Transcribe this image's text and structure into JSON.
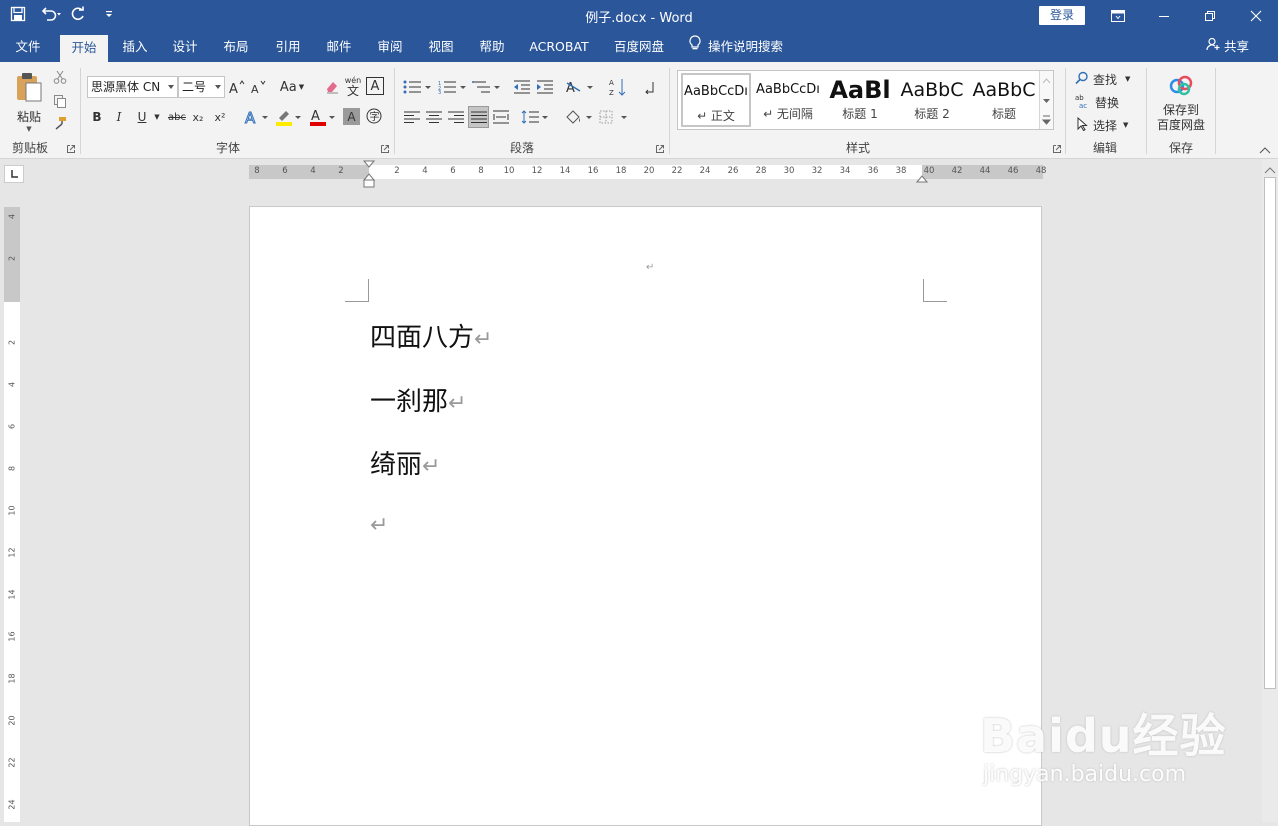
{
  "window": {
    "title": "例子.docx  -  Word",
    "login_label": "登录"
  },
  "tabs": [
    {
      "label": "文件"
    },
    {
      "label": "开始"
    },
    {
      "label": "插入"
    },
    {
      "label": "设计"
    },
    {
      "label": "布局"
    },
    {
      "label": "引用"
    },
    {
      "label": "邮件"
    },
    {
      "label": "审阅"
    },
    {
      "label": "视图"
    },
    {
      "label": "帮助"
    },
    {
      "label": "ACROBAT"
    },
    {
      "label": "百度网盘"
    }
  ],
  "tell_me": "操作说明搜索",
  "share": "共享",
  "ribbon": {
    "clipboard": {
      "paste_label": "粘贴",
      "group_label": "剪贴板"
    },
    "font": {
      "font_name": "思源黑体 CN",
      "font_size": "二号",
      "group_label": "字体",
      "aa_label": "Aa",
      "bold": "B",
      "italic": "I",
      "underline": "U",
      "strike": "abc",
      "sub": "x₂",
      "sup": "x²",
      "wen_label": "wén",
      "wen_char": "文",
      "a_label": "A"
    },
    "paragraph": {
      "group_label": "段落"
    },
    "styles": {
      "group_label": "样式",
      "items": [
        {
          "preview": "AaBbCcDı",
          "name": "↵ 正文"
        },
        {
          "preview": "AaBbCcDı",
          "name": "↵ 无间隔"
        },
        {
          "preview": "AaBl",
          "name": "标题 1"
        },
        {
          "preview": "AaBbC",
          "name": "标题 2"
        },
        {
          "preview": "AaBbC",
          "name": "标题"
        }
      ]
    },
    "editing": {
      "find": "查找",
      "replace": "替换",
      "select": "选择",
      "group_label": "编辑"
    },
    "save": {
      "line1": "保存到",
      "line2": "百度网盘",
      "group_label": "保存"
    }
  },
  "ruler_h": [
    "8",
    "6",
    "4",
    "2",
    "2",
    "4",
    "6",
    "8",
    "10",
    "12",
    "14",
    "16",
    "18",
    "20",
    "22",
    "24",
    "26",
    "28",
    "30",
    "32",
    "34",
    "36",
    "38",
    "40",
    "42",
    "44",
    "46",
    "48"
  ],
  "ruler_v": [
    "4",
    "2",
    "2",
    "4",
    "6",
    "8",
    "10",
    "12",
    "14",
    "16",
    "18",
    "20",
    "22",
    "24"
  ],
  "document": {
    "header_mark": "↵",
    "paragraphs": [
      {
        "text": "四面八方",
        "mark": "↵"
      },
      {
        "text": "一刹那",
        "mark": "↵"
      },
      {
        "text": "绮丽",
        "mark": "↵"
      },
      {
        "text": "",
        "mark": "↵"
      }
    ]
  },
  "watermark": {
    "brand": "Baidu经验",
    "url": "jingyan.baidu.com"
  },
  "colors": {
    "title_bar": "#2b579a",
    "ribbon_bg": "#f3f3f3",
    "canvas_bg": "#e6e6e6"
  }
}
